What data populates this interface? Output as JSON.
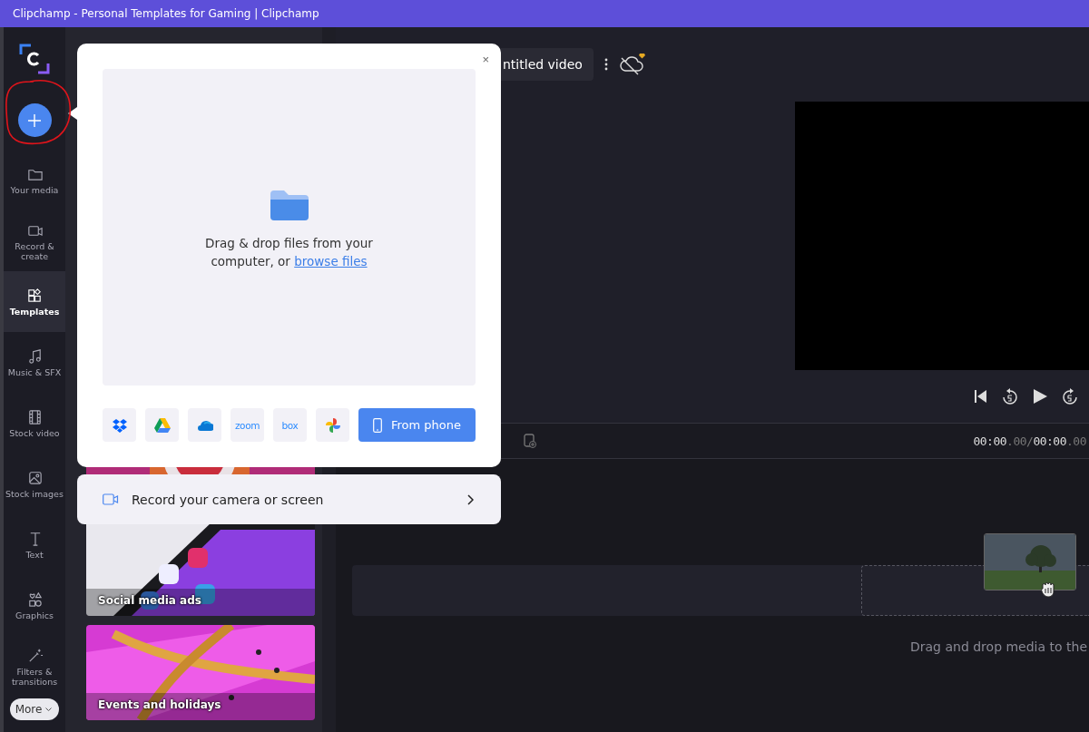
{
  "window": {
    "title": "Clipchamp - Personal Templates for Gaming | Clipchamp"
  },
  "nav": {
    "items": [
      {
        "label": "Your media",
        "selected": false
      },
      {
        "label": "Record & create",
        "selected": false
      },
      {
        "label": "Templates",
        "selected": true
      },
      {
        "label": "Music & SFX",
        "selected": false
      },
      {
        "label": "Stock video",
        "selected": false
      },
      {
        "label": "Stock images",
        "selected": false
      },
      {
        "label": "Text",
        "selected": false
      },
      {
        "label": "Graphics",
        "selected": false
      },
      {
        "label": "Filters & transitions",
        "selected": false
      }
    ],
    "more": "More"
  },
  "templates": {
    "cards": [
      {
        "kind": "picture"
      },
      {
        "kind": "picture",
        "title": "Social media ads"
      },
      {
        "kind": "picture",
        "title": "Events and holidays"
      }
    ]
  },
  "upload": {
    "close": "×",
    "drop_text": "Drag & drop files from your computer, or",
    "link": "browse files",
    "services": [
      {
        "kind": "diamonds"
      },
      {
        "kind": "triangle"
      },
      {
        "kind": "cloud"
      },
      {
        "kind": "wordmark",
        "label": "zoom"
      },
      {
        "kind": "wordmark",
        "label": "box"
      },
      {
        "kind": "pinwheel"
      }
    ],
    "phone_button": "From phone"
  },
  "record": {
    "label": "Record your camera or screen"
  },
  "editor": {
    "title": "ntitled video",
    "time": {
      "current": "00:00",
      "current_fraction": ".00",
      "separator": "/",
      "total": "00:00",
      "total_fraction": ".00"
    },
    "hint": "Drag and drop media to the"
  }
}
